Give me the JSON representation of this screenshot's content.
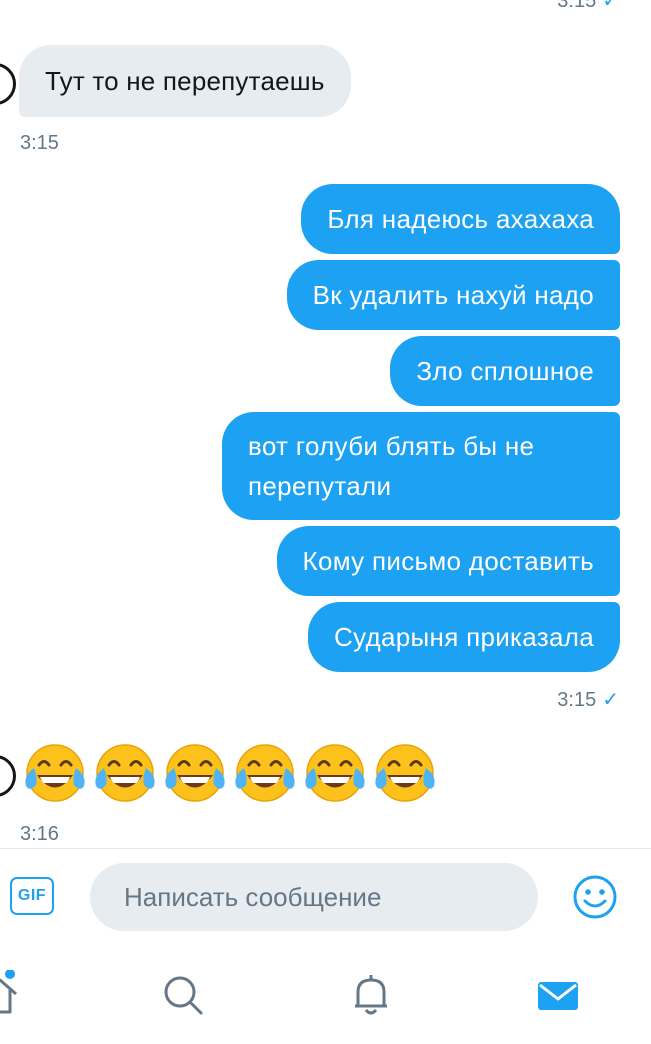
{
  "conversation": {
    "top_time": "3:15",
    "incoming_1": {
      "text": "Тут то не перепутаешь",
      "time": "3:15"
    },
    "outgoing": [
      "Бля надеюсь ахахаха",
      "Вк удалить нахуй надо",
      "Зло сплошное",
      "вот голуби блять бы не перепутали",
      "Кому письмо доставить",
      "Сударыня приказала"
    ],
    "outgoing_multiline": [
      "вот голуби блять бы не",
      "перепутали"
    ],
    "outgoing_time": "3:15",
    "incoming_2": {
      "emoji": "😂😂😂😂😂😂",
      "count": 6,
      "time": "3:16"
    }
  },
  "composer": {
    "gif_label": "GIF",
    "placeholder": "Написать сообщение"
  },
  "tab_bar": {
    "tabs": [
      "home-icon",
      "search-icon",
      "notifications-icon",
      "messages-icon"
    ],
    "active": "messages-icon",
    "notification_dot": true
  },
  "colors": {
    "accent": "#1da1f2",
    "incoming_bubble": "#e6ecf0",
    "muted_text": "#657786",
    "inactive_icon": "#657786"
  }
}
